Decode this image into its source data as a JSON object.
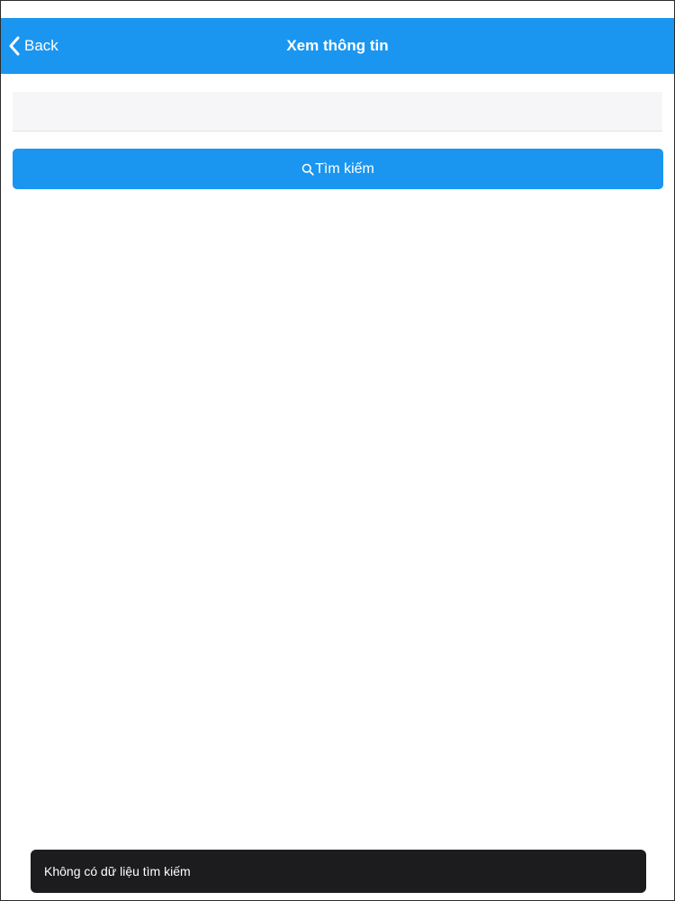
{
  "navbar": {
    "back_label": "Back",
    "title": "Xem thông tin",
    "background_color": "#1a96f0"
  },
  "search": {
    "input_value": "",
    "input_placeholder": "",
    "button_label": "Tìm kiếm",
    "button_icon": "search-icon",
    "button_color": "#1a96f0"
  },
  "toast": {
    "message": "Không có dữ liệu tìm kiếm",
    "background_color": "#1c1c1e"
  }
}
